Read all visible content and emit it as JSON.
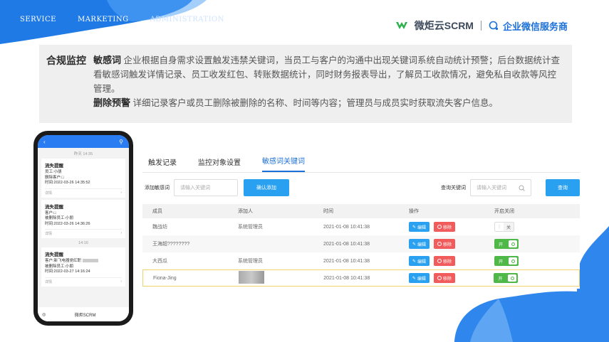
{
  "nav": {
    "items": [
      "SERVICE",
      "MARKETING",
      "ADMINISTRATION"
    ]
  },
  "brand": {
    "name": "微炬云SCRM",
    "partner": "企业微信服务商"
  },
  "info": {
    "title": "合规监控",
    "p1_key": "敏感词",
    "p1_text": "企业根据自身需求设置触发违禁关键词，当员工与客户的沟通中出现关键词系统自动统计预警；后台数据统计查看敏感词触发详情记录、员工收发红包、转账数据统计，同时财务报表导出，了解员工收款情况，避免私自收款等风控管理。",
    "p2_key": "删除预警",
    "p2_text": "详细记录客户或员工删除被删除的名称、时间等内容；管理员与成员实时获取流失客户信息。"
  },
  "phone": {
    "back": "‹",
    "user": "⚲",
    "times": [
      "昨天 14:35",
      "14:16"
    ],
    "messages": [
      {
        "title": "流失提醒",
        "lines": [
          "员工:小朋",
          "删除客户:□",
          "时间:2022-03-26 14:35:52"
        ],
        "more": "详情"
      },
      {
        "title": "流失提醒",
        "lines": [
          "客户:□",
          "被删除员工:小朋",
          "时间:2022-03-26 14:36:26"
        ],
        "more": "详情"
      },
      {
        "title": "流失提醒",
        "lines": [
          "客户:新飞电器党红职",
          "被删除员工:小朋",
          "时间:2022-03-27 14:16:24"
        ],
        "more": "详情"
      }
    ],
    "footer": "微炬SCRM"
  },
  "tabs": [
    "触发记录",
    "监控对象设置",
    "敏感词关键词"
  ],
  "toolbar": {
    "add_label": "添加敏感词",
    "add_placeholder": "请输入关键词",
    "add_button": "确认添加",
    "query_label": "查询关键词",
    "query_placeholder": "请输入关键词",
    "query_button": "查询"
  },
  "table": {
    "headers": [
      "成员",
      "添加人",
      "时间",
      "操作",
      "开启关闭"
    ],
    "edit": "编辑",
    "remove": "移除",
    "off": "关",
    "on": "开",
    "rows": [
      {
        "member": "魏战坊",
        "adder": "系统管理员",
        "time": "2021-01-08 10:41:38",
        "state": "off"
      },
      {
        "member": "王海超????????",
        "adder": "",
        "time": "2021-01-08 10:41:38",
        "state": "on"
      },
      {
        "member": "大西瓜",
        "adder": "系统管理员",
        "time": "2021-01-08 10:41:38",
        "state": "on"
      },
      {
        "member": "Fiona-Jing",
        "adder": "",
        "time": "2021-01-08 10:41:38",
        "state": "on"
      }
    ]
  },
  "colors": {
    "accent": "#2aa0f0",
    "danger": "#f15b5b",
    "success": "#4fb848",
    "brand_blue": "#1a6fd8"
  }
}
